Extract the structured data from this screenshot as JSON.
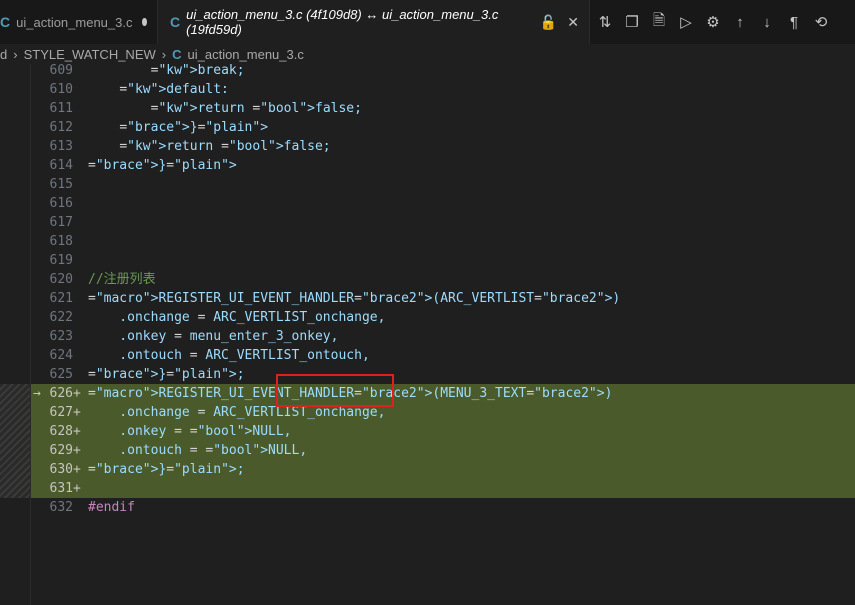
{
  "tabs": [
    {
      "icon": "C",
      "label": "ui_action_menu_3.c",
      "dirty": true
    },
    {
      "icon": "C",
      "label": "ui_action_menu_3.c (4f109d8) ↔ ui_action_menu_3.c (19fd59d)",
      "active": true
    }
  ],
  "toolbar": {
    "icons": [
      "compare-changes-icon",
      "copy-icon",
      "open-file-icon",
      "run-icon",
      "settings-icon",
      "arrow-up-icon",
      "arrow-down-icon",
      "pilcrow-icon",
      "revert-icon"
    ],
    "glyphs": [
      "⇅",
      "❐",
      "🗎",
      "▷",
      "⚙",
      "↑",
      "↓",
      "¶",
      "⟲"
    ]
  },
  "breadcrumb": {
    "prefix": "d",
    "folder": "STYLE_WATCH_NEW",
    "icon": "C",
    "file": "ui_action_menu_3.c"
  },
  "lines": [
    {
      "n": "609",
      "text": "        break;"
    },
    {
      "n": "610",
      "text": "    default:"
    },
    {
      "n": "611",
      "text": "        return false;"
    },
    {
      "n": "612",
      "text": "    }"
    },
    {
      "n": "613",
      "text": "    return false;"
    },
    {
      "n": "614",
      "text": "}"
    },
    {
      "n": "615",
      "text": ""
    },
    {
      "n": "616",
      "text": ""
    },
    {
      "n": "617",
      "text": ""
    },
    {
      "n": "618",
      "text": ""
    },
    {
      "n": "619",
      "text": ""
    },
    {
      "n": "620",
      "text": "//注册列表"
    },
    {
      "n": "621",
      "text": "REGISTER_UI_EVENT_HANDLER(ARC_VERTLIST)"
    },
    {
      "n": "622",
      "text": "    .onchange = ARC_VERTLIST_onchange,"
    },
    {
      "n": "623",
      "text": "    .onkey = menu_enter_3_onkey,"
    },
    {
      "n": "624",
      "text": "    .ontouch = ARC_VERTLIST_ontouch,"
    },
    {
      "n": "625",
      "text": "};"
    },
    {
      "n": "626",
      "text": "REGISTER_UI_EVENT_HANDLER(MENU_3_TEXT)",
      "added": true,
      "marker": "→"
    },
    {
      "n": "627",
      "text": "    .onchange = ARC_VERTLIST_onchange,",
      "added": true
    },
    {
      "n": "628",
      "text": "    .onkey = NULL,",
      "added": true
    },
    {
      "n": "629",
      "text": "    .ontouch = NULL,",
      "added": true
    },
    {
      "n": "630",
      "text": "};",
      "added": true
    },
    {
      "n": "631",
      "text": "",
      "added": true
    },
    {
      "n": "632",
      "text": "#endif"
    }
  ],
  "colors": {
    "added_bg": "#4b5a2a",
    "highlight_border": "#e02020"
  }
}
